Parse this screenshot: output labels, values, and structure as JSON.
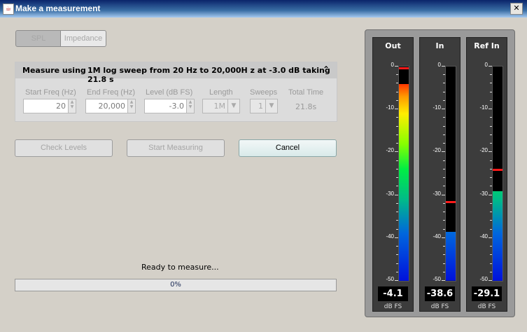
{
  "window": {
    "title": "Make a measurement",
    "close_glyph": "✕"
  },
  "mode_toggle": {
    "spl_label": "SPL",
    "impedance_label": "Impedance"
  },
  "measure": {
    "label": "Measure using",
    "description": "1M log sweep from 20 Hz to 20,000H z at -3.0 dB taking 21.8 s",
    "collapse_glyph": "⌃",
    "fields": {
      "start_freq": {
        "label": "Start Freq (Hz)",
        "value": "20"
      },
      "end_freq": {
        "label": "End Freq (Hz)",
        "value": "20,000"
      },
      "level": {
        "label": "Level (dB FS)",
        "value": "-3.0"
      },
      "length": {
        "label": "Length",
        "value": "1M"
      },
      "sweeps": {
        "label": "Sweeps",
        "value": "1"
      },
      "total_time": {
        "label": "Total Time",
        "value": "21.8s"
      }
    }
  },
  "buttons": {
    "check_levels": "Check Levels",
    "start_measuring": "Start Measuring",
    "cancel": "Cancel"
  },
  "status": {
    "text": "Ready to measure...",
    "progress_label": "0%",
    "progress_value": 0
  },
  "meters": {
    "scale_labels": [
      "0",
      "-10",
      "-20",
      "-30",
      "-40",
      "-50"
    ],
    "unit": "dB FS",
    "out": {
      "title": "Out",
      "readout": "-4.1",
      "level_db": -4.1,
      "peak_db": -0.3
    },
    "in": {
      "title": "In",
      "readout": "-38.6",
      "level_db": -38.6,
      "peak_db": -31.5
    },
    "ref_in": {
      "title": "Ref In",
      "readout": "-29.1",
      "level_db": -29.1,
      "peak_db": -24.0
    }
  }
}
